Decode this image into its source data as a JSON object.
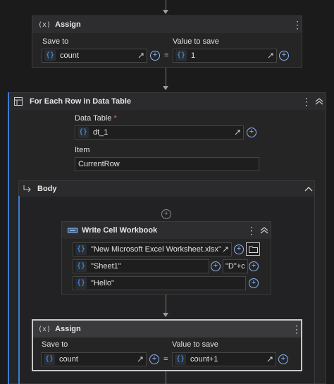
{
  "assign1": {
    "title": "Assign",
    "save_to_label": "Save to",
    "value_to_save_label": "Value to save",
    "save_to_value": "count",
    "value_value": "1",
    "equals": "="
  },
  "foreach": {
    "title": "For Each Row in Data Table",
    "data_table_label": "Data Table",
    "required_mark": "*",
    "data_table_value": "dt_1",
    "item_label": "Item",
    "item_value": "CurrentRow"
  },
  "body": {
    "title": "Body"
  },
  "write_cell": {
    "title": "Write Cell Workbook",
    "workbook_value": "\"New Microsoft Excel Worksheet.xlsx\"",
    "sheet_value": "\"Sheet1\"",
    "cell_value": "\"D\"+c",
    "text_value": "\"Hello\""
  },
  "assign2": {
    "title": "Assign",
    "save_to_label": "Save to",
    "value_to_save_label": "Value to save",
    "save_to_value": "count",
    "value_value": "count+1",
    "equals": "="
  },
  "icons": {
    "variable": "braces-icon",
    "assign": "assign-icon",
    "foreach": "table-icon",
    "excel": "excel-icon",
    "body": "enter-arrow-icon",
    "add": "plus-circle-icon",
    "folder": "folder-icon",
    "expand": "expand-icon",
    "kebab": "kebab-icon",
    "collapse": "chevron-up-icon"
  },
  "colors": {
    "background": "#1b1b1b",
    "card": "#252526",
    "header": "#2d2d30",
    "accent": "#4aa3ff",
    "selected_border": "#c8c8c8"
  }
}
